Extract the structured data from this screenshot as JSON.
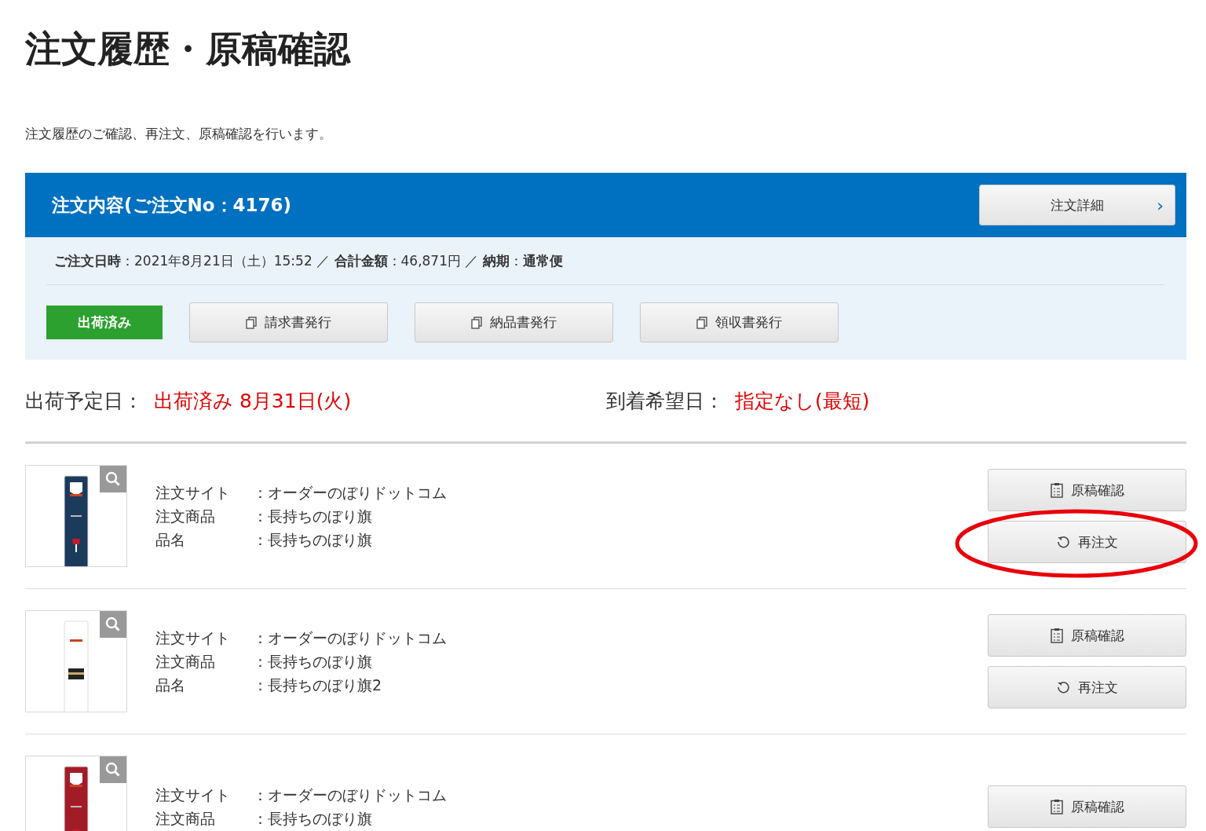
{
  "title": "注文履歴・原稿確認",
  "description": "注文履歴のご確認、再注文、原稿確認を行います。",
  "order": {
    "heading": "注文内容(ご注文No：4176)",
    "detail_button": "注文詳細",
    "detail_chevron": "›",
    "meta": "**ご注文日時**：2021年8月21日（土）15:52 ／ **合計金額**：46,871円 ／ **納期**：**通常便**",
    "status": "出荷済み",
    "doc_buttons": [
      "請求書発行",
      "納品書発行",
      "領収書発行"
    ]
  },
  "schedule": {
    "ship_label": "出荷予定日：",
    "ship_value": "出荷済み 8月31日(火)",
    "arrival_label": "到着希望日：",
    "arrival_value": "指定なし(最短)"
  },
  "items": [
    {
      "thumbnail": {
        "kind": "picture"
      },
      "rows": [
        {
          "label": "注文サイト",
          "value": "：オーダーのぼりドットコム"
        },
        {
          "label": "注文商品",
          "value": "：長持ちのぼり旗"
        },
        {
          "label": "品名",
          "value": "：長持ちのぼり旗"
        }
      ],
      "proof_button": "原稿確認",
      "reorder_button": "再注文",
      "circled": true
    },
    {
      "thumbnail": {
        "kind": "picture"
      },
      "rows": [
        {
          "label": "注文サイト",
          "value": "：オーダーのぼりドットコム"
        },
        {
          "label": "注文商品",
          "value": "：長持ちのぼり旗"
        },
        {
          "label": "品名",
          "value": "：長持ちのぼり旗2"
        }
      ],
      "proof_button": "原稿確認",
      "reorder_button": "再注文",
      "circled": false
    },
    {
      "thumbnail": {
        "kind": "picture"
      },
      "rows": [
        {
          "label": "注文サイト",
          "value": "：オーダーのぼりドットコム"
        },
        {
          "label": "注文商品",
          "value": "：長持ちのぼり旗"
        }
      ],
      "proof_button": "原稿確認",
      "circled": false
    }
  ]
}
